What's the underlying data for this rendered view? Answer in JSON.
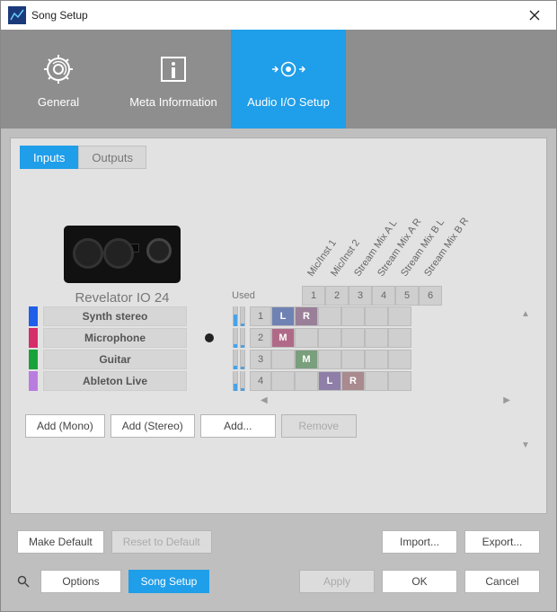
{
  "window": {
    "title": "Song Setup"
  },
  "top_tabs": {
    "general": "General",
    "meta": "Meta Information",
    "audio_io": "Audio I/O Setup",
    "active_index": 2
  },
  "io_tabs": {
    "inputs": "Inputs",
    "outputs": "Outputs",
    "active_index": 0
  },
  "device": {
    "name": "Revelator IO 24"
  },
  "used_label": "Used",
  "channels": [
    {
      "label": "Mic/Inst 1",
      "num": "1"
    },
    {
      "label": "Mic/Inst 2",
      "num": "2"
    },
    {
      "label": "Stream Mix A L",
      "num": "3"
    },
    {
      "label": "Stream Mix A R",
      "num": "4"
    },
    {
      "label": "Stream Mix B L",
      "num": "5"
    },
    {
      "label": "Stream Mix B R",
      "num": "6"
    }
  ],
  "rows": [
    {
      "name": "Synth stereo",
      "color": "#1f5fe9",
      "num": "1",
      "used": false,
      "cells": [
        "L",
        "R",
        "",
        "",
        "",
        ""
      ],
      "cell_colors": [
        "#6f82b4",
        "#9a7f99",
        "",
        "",
        "",
        ""
      ]
    },
    {
      "name": "Microphone",
      "color": "#d62e6b",
      "num": "2",
      "used": true,
      "cells": [
        "M",
        "",
        "",
        "",
        "",
        ""
      ],
      "cell_colors": [
        "#b06a87",
        "",
        "",
        "",
        "",
        ""
      ]
    },
    {
      "name": "Guitar",
      "color": "#17a33a",
      "num": "3",
      "used": false,
      "cells": [
        "",
        "M",
        "",
        "",
        "",
        ""
      ],
      "cell_colors": [
        "",
        "#7a9f7d",
        "",
        "",
        "",
        ""
      ]
    },
    {
      "name": "Ableton Live",
      "color": "#b97de0",
      "num": "4",
      "used": false,
      "cells": [
        "",
        "",
        "L",
        "R",
        "",
        ""
      ],
      "cell_colors": [
        "",
        "",
        "#8f7fa8",
        "#a88a8f",
        "",
        ""
      ]
    }
  ],
  "buttons": {
    "add_mono": "Add (Mono)",
    "add_stereo": "Add (Stereo)",
    "add": "Add...",
    "remove": "Remove",
    "make_default": "Make Default",
    "reset_default": "Reset to Default",
    "import": "Import...",
    "export": "Export...",
    "options": "Options",
    "song_setup": "Song Setup",
    "apply": "Apply",
    "ok": "OK",
    "cancel": "Cancel"
  }
}
